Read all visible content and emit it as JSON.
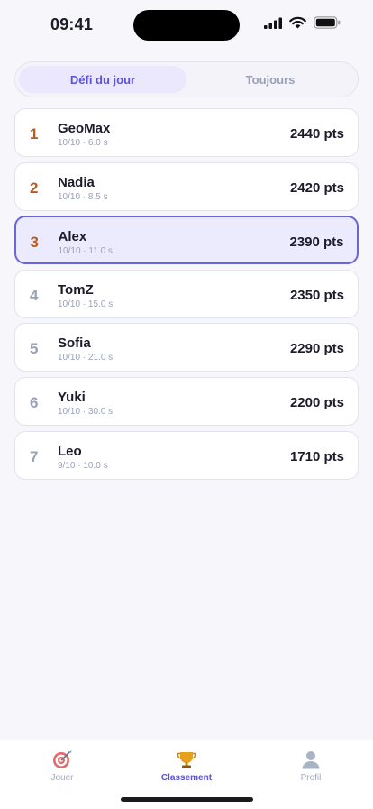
{
  "status_bar": {
    "time": "09:41"
  },
  "segment": {
    "tabs": [
      {
        "label": "Défi du jour",
        "active": true
      },
      {
        "label": "Toujours",
        "active": false
      }
    ]
  },
  "leaderboard": {
    "rows": [
      {
        "rank": "1",
        "name": "GeoMax",
        "meta": "10/10 · 6.0 s",
        "score": "2440 pts"
      },
      {
        "rank": "2",
        "name": "Nadia",
        "meta": "10/10 · 8.5 s",
        "score": "2420 pts"
      },
      {
        "rank": "3",
        "name": "Alex",
        "meta": "10/10 · 11.0 s",
        "score": "2390 pts",
        "current_user": true
      },
      {
        "rank": "4",
        "name": "TomZ",
        "meta": "10/10 · 15.0 s",
        "score": "2350 pts"
      },
      {
        "rank": "5",
        "name": "Sofia",
        "meta": "10/10 · 21.0 s",
        "score": "2290 pts"
      },
      {
        "rank": "6",
        "name": "Yuki",
        "meta": "10/10 · 30.0 s",
        "score": "2200 pts"
      },
      {
        "rank": "7",
        "name": "Leo",
        "meta": "9/10 · 10.0 s",
        "score": "1710 pts"
      }
    ]
  },
  "tabbar": {
    "items": [
      {
        "label": "Jouer",
        "icon": "target-icon",
        "active": false
      },
      {
        "label": "Classement",
        "icon": "trophy-icon",
        "active": true
      },
      {
        "label": "Profil",
        "icon": "profile-icon",
        "active": false
      }
    ]
  },
  "colors": {
    "accent": "#5b53d6",
    "podium_rank": "#b85c24",
    "muted": "#9aa1b6",
    "current_row_bg": "#ecebfd",
    "current_row_border": "#6a66d8"
  }
}
